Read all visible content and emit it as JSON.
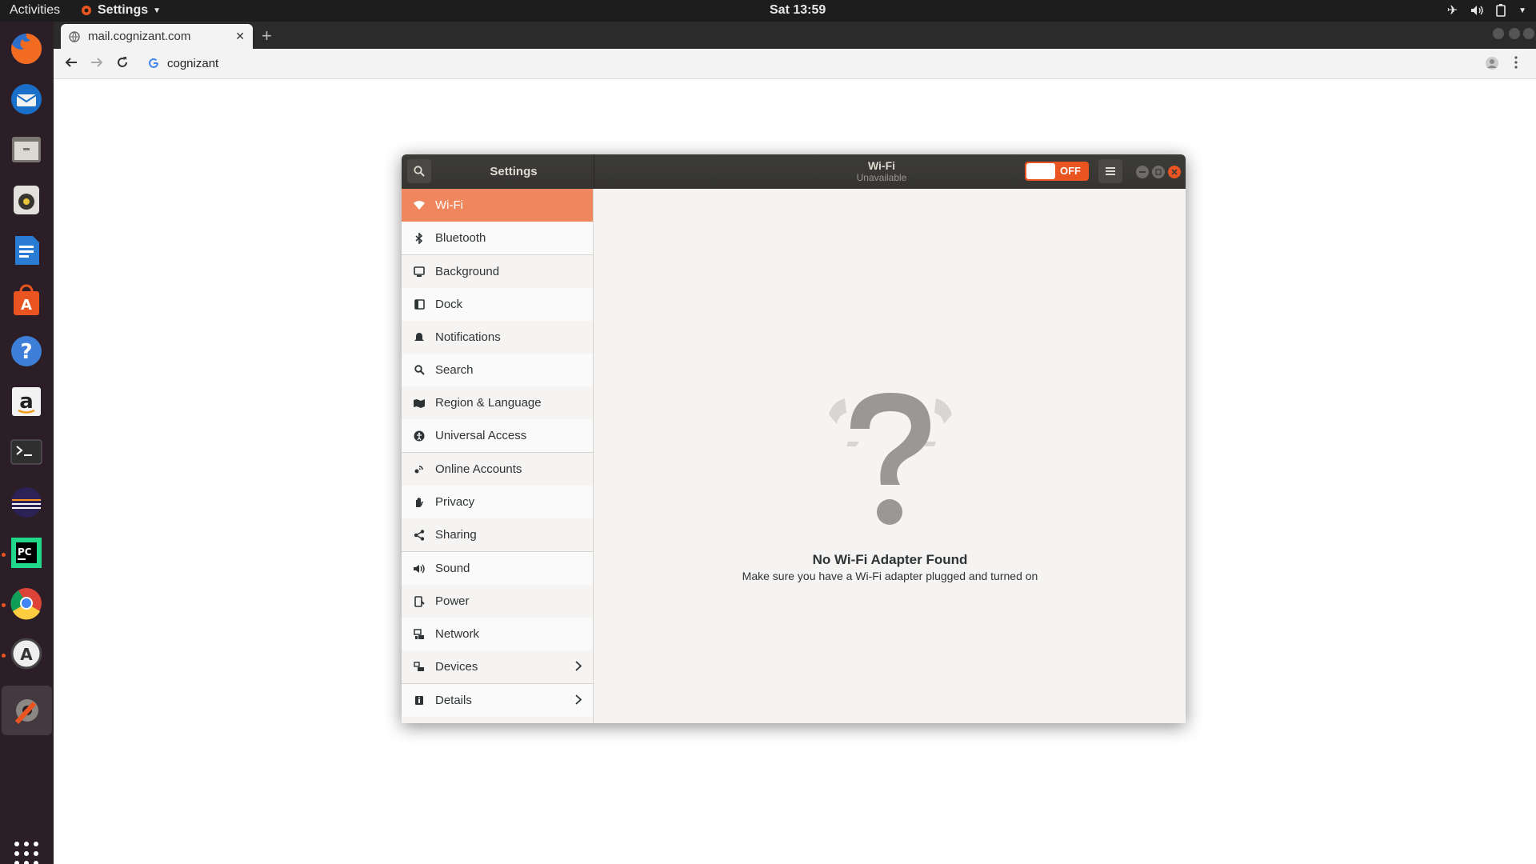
{
  "topbar": {
    "activities": "Activities",
    "app_name": "Settings",
    "clock": "Sat 13:59"
  },
  "browser": {
    "tab_title": "mail.cognizant.com",
    "new_tab": "+",
    "address": "cognizant"
  },
  "settings": {
    "sidebar_title": "Settings",
    "page_title": "Wi-Fi",
    "page_subtitle": "Unavailable",
    "toggle_label": "OFF",
    "toggle_state": "off",
    "accent_color": "#e95420",
    "selected_color": "#f0865d",
    "sidebar": [
      {
        "label": "Wi-Fi",
        "icon": "wifi-icon",
        "selected": true
      },
      {
        "label": "Bluetooth",
        "icon": "bluetooth-icon"
      },
      {
        "label": "Background",
        "icon": "background-icon"
      },
      {
        "label": "Dock",
        "icon": "dock-icon"
      },
      {
        "label": "Notifications",
        "icon": "bell-icon"
      },
      {
        "label": "Search",
        "icon": "search-icon"
      },
      {
        "label": "Region & Language",
        "icon": "region-icon"
      },
      {
        "label": "Universal Access",
        "icon": "accessibility-icon"
      },
      {
        "label": "Online Accounts",
        "icon": "online-accounts-icon"
      },
      {
        "label": "Privacy",
        "icon": "hand-icon"
      },
      {
        "label": "Sharing",
        "icon": "share-icon"
      },
      {
        "label": "Sound",
        "icon": "speaker-icon"
      },
      {
        "label": "Power",
        "icon": "power-icon"
      },
      {
        "label": "Network",
        "icon": "network-icon"
      },
      {
        "label": "Devices",
        "icon": "devices-icon",
        "has_submenu": true
      },
      {
        "label": "Details",
        "icon": "info-icon",
        "has_submenu": true
      }
    ],
    "empty_title": "No Wi-Fi Adapter Found",
    "empty_subtitle": "Make sure you have a Wi-Fi adapter plugged and turned on"
  },
  "dock": [
    "firefox-icon",
    "thunderbird-icon",
    "files-icon",
    "rhythmbox-icon",
    "writer-icon",
    "software-center-icon",
    "help-icon",
    "amazon-icon",
    "terminal-icon",
    "eclipse-icon",
    "pycharm-icon",
    "chrome-icon",
    "software-updater-icon",
    "settings-app-icon",
    "show-apps-icon"
  ]
}
